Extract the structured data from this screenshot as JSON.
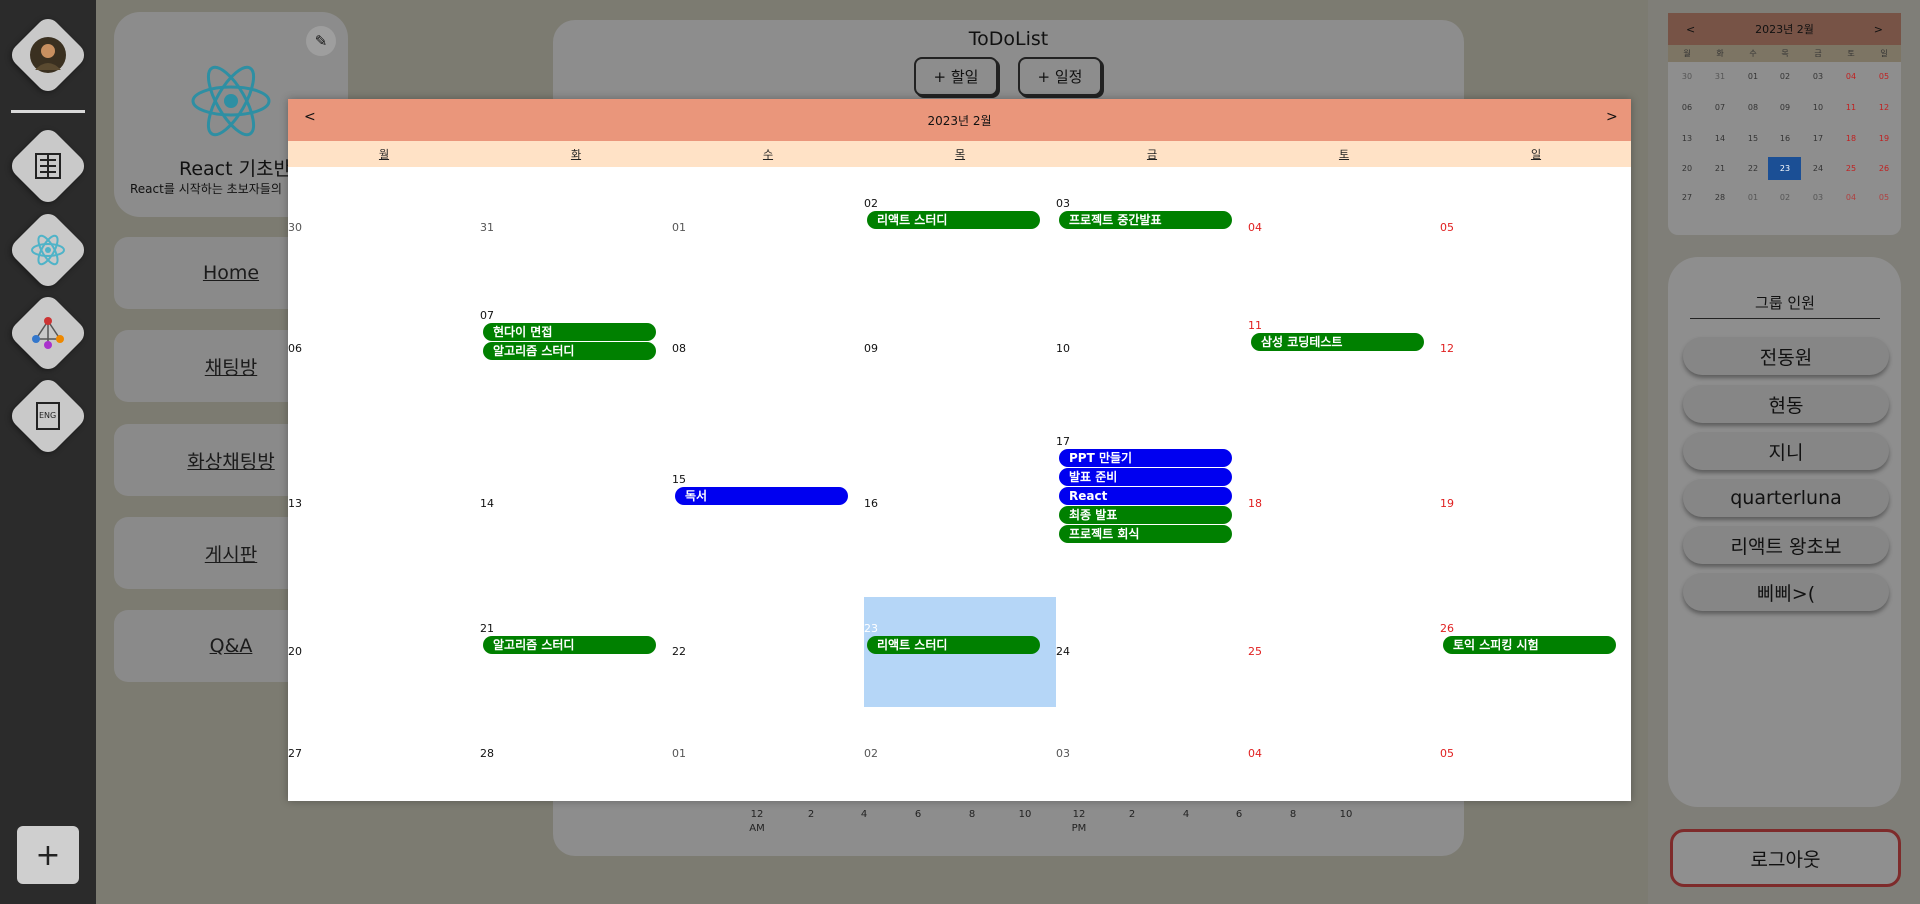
{
  "rail": {
    "add_label": "+"
  },
  "group": {
    "title": "React 기초반",
    "description": "React를 시작하는 초보자들의"
  },
  "nav": {
    "items": [
      {
        "label": "Home"
      },
      {
        "label": "채팅방"
      },
      {
        "label": "화상채팅방"
      },
      {
        "label": "게시판"
      },
      {
        "label": "Q&A"
      }
    ]
  },
  "todo": {
    "title": "ToDoList",
    "add_todo_label": "+ 할일",
    "add_schedule_label": "+ 일정",
    "timeline": [
      {
        "t": "12",
        "s": "AM"
      },
      {
        "t": "2",
        "s": ""
      },
      {
        "t": "4",
        "s": ""
      },
      {
        "t": "6",
        "s": ""
      },
      {
        "t": "8",
        "s": ""
      },
      {
        "t": "10",
        "s": ""
      },
      {
        "t": "12",
        "s": "PM"
      },
      {
        "t": "2",
        "s": ""
      },
      {
        "t": "4",
        "s": ""
      },
      {
        "t": "6",
        "s": ""
      },
      {
        "t": "8",
        "s": ""
      },
      {
        "t": "10",
        "s": ""
      }
    ]
  },
  "mini_calendar": {
    "title": "2023년 2월",
    "prev": "<",
    "next": ">",
    "weekdays": [
      "월",
      "화",
      "수",
      "목",
      "금",
      "토",
      "일"
    ],
    "weeks": [
      [
        "30",
        "31",
        "01",
        "02",
        "03",
        "04",
        "05"
      ],
      [
        "06",
        "07",
        "08",
        "09",
        "10",
        "11",
        "12"
      ],
      [
        "13",
        "14",
        "15",
        "16",
        "17",
        "18",
        "19"
      ],
      [
        "20",
        "21",
        "22",
        "23",
        "24",
        "25",
        "26"
      ],
      [
        "27",
        "28",
        "01",
        "02",
        "03",
        "04",
        "05"
      ]
    ],
    "selected": "23"
  },
  "members": {
    "title": "그룹 인원",
    "list": [
      "전동원",
      "현동",
      "지니",
      "quarterluna",
      "리액트 왕초보",
      "삐삐>("
    ]
  },
  "logout_label": "로그아웃",
  "calendar": {
    "title": "2023년 2월",
    "prev": "<",
    "next": ">",
    "weekdays": [
      "월",
      "화",
      "수",
      "목",
      "금",
      "토",
      "일"
    ],
    "weeks": [
      [
        "30",
        "31",
        "01",
        "02",
        "03",
        "04",
        "05"
      ],
      [
        "06",
        "07",
        "08",
        "09",
        "10",
        "11",
        "12"
      ],
      [
        "13",
        "14",
        "15",
        "16",
        "17",
        "18",
        "19"
      ],
      [
        "20",
        "21",
        "22",
        "23",
        "24",
        "25",
        "26"
      ],
      [
        "27",
        "28",
        "01",
        "02",
        "03",
        "04",
        "05"
      ]
    ],
    "selected_day": "23",
    "events": [
      {
        "week": 0,
        "day": 3,
        "title": "리액트 스터디",
        "color": "green"
      },
      {
        "week": 0,
        "day": 4,
        "title": "프로젝트 중간발표",
        "color": "green"
      },
      {
        "week": 1,
        "day": 1,
        "title": "현다이 면접",
        "color": "green"
      },
      {
        "week": 1,
        "day": 1,
        "title": "알고리즘 스터디",
        "color": "green"
      },
      {
        "week": 1,
        "day": 5,
        "title": "삼성 코딩테스트",
        "color": "green"
      },
      {
        "week": 2,
        "day": 2,
        "title": "독서",
        "color": "blue"
      },
      {
        "week": 2,
        "day": 4,
        "title": "PPT 만들기",
        "color": "blue"
      },
      {
        "week": 2,
        "day": 4,
        "title": "발표 준비",
        "color": "blue"
      },
      {
        "week": 2,
        "day": 4,
        "title": "React",
        "color": "blue"
      },
      {
        "week": 2,
        "day": 4,
        "title": "최종 발표",
        "color": "green"
      },
      {
        "week": 2,
        "day": 4,
        "title": "프로젝트 회식",
        "color": "green"
      },
      {
        "week": 3,
        "day": 1,
        "title": "알고리즘 스터디",
        "color": "green"
      },
      {
        "week": 3,
        "day": 3,
        "title": "리액트 스터디",
        "color": "green"
      },
      {
        "week": 3,
        "day": 6,
        "title": "토익 스피킹 시험",
        "color": "green"
      }
    ]
  }
}
